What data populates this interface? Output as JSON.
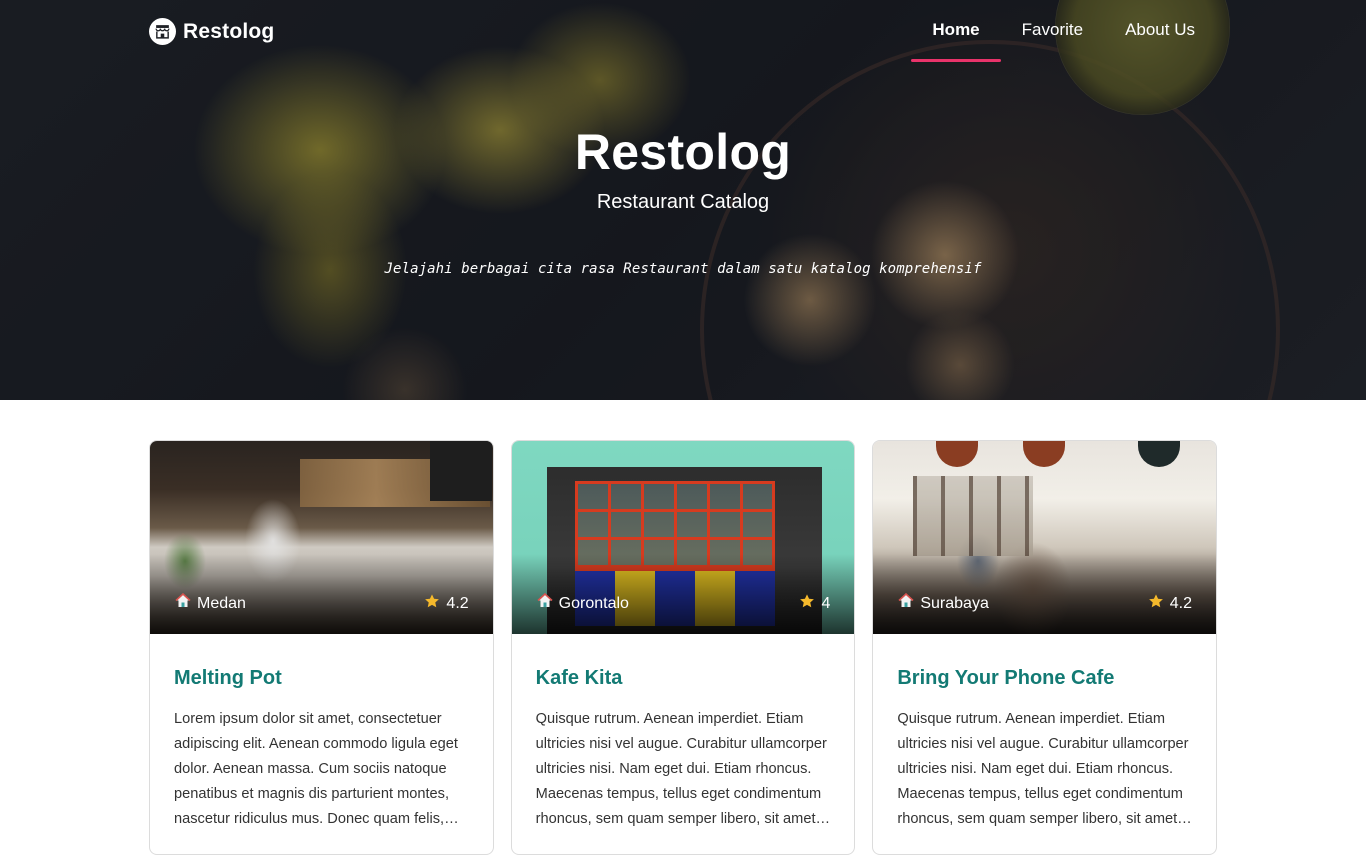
{
  "brand": {
    "name": "Restolog",
    "icon": "store-icon"
  },
  "nav": {
    "items": [
      {
        "label": "Home",
        "active": true
      },
      {
        "label": "Favorite",
        "active": false
      },
      {
        "label": "About Us",
        "active": false
      }
    ],
    "active_color": "#e9336a"
  },
  "hero": {
    "title": "Restolog",
    "subtitle": "Restaurant Catalog",
    "tagline": "Jelajahi berbagai cita rasa Restaurant dalam satu katalog komprehensif"
  },
  "colors": {
    "card_title": "#137a74",
    "rating_star": "#f5b92c"
  },
  "restaurants": [
    {
      "name": "Melting Pot",
      "city": "Medan",
      "rating": "4.2",
      "description": "Lorem ipsum dolor sit amet, consectetuer adipiscing elit. Aenean commodo ligula eget dolor. Aenean massa. Cum sociis natoque penatibus et magnis dis parturient montes, nascetur ridiculus mus. Donec quam felis, ultricies nec, pellentesque eu, pretium quis, sem."
    },
    {
      "name": "Kafe Kita",
      "city": "Gorontalo",
      "rating": "4",
      "description": "Quisque rutrum. Aenean imperdiet. Etiam ultricies nisi vel augue. Curabitur ullamcorper ultricies nisi. Nam eget dui. Etiam rhoncus. Maecenas tempus, tellus eget condimentum rhoncus, sem quam semper libero, sit amet adipiscing sem neque sed ipsum."
    },
    {
      "name": "Bring Your Phone Cafe",
      "city": "Surabaya",
      "rating": "4.2",
      "description": "Quisque rutrum. Aenean imperdiet. Etiam ultricies nisi vel augue. Curabitur ullamcorper ultricies nisi. Nam eget dui. Etiam rhoncus. Maecenas tempus, tellus eget condimentum rhoncus, sem quam semper libero, sit amet adipiscing sem neque sed ipsum."
    }
  ]
}
